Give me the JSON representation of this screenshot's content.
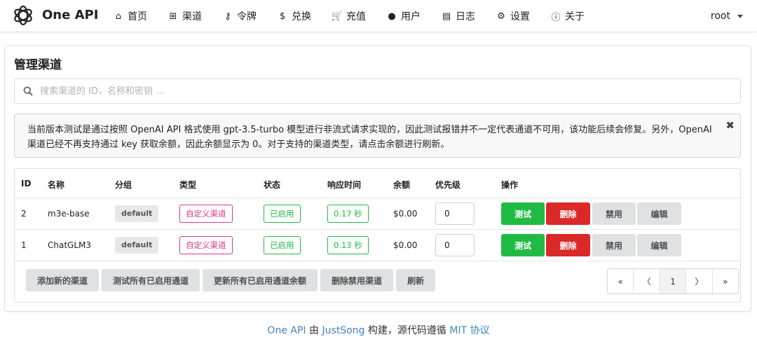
{
  "nav": {
    "brand": "One API",
    "items": [
      {
        "label": "首页",
        "icon": "home-icon",
        "glyph": "⌂"
      },
      {
        "label": "渠道",
        "icon": "sitemap-icon",
        "glyph": "⊞"
      },
      {
        "label": "令牌",
        "icon": "key-icon",
        "glyph": "⚷"
      },
      {
        "label": "兑换",
        "icon": "dollar-icon",
        "glyph": "$"
      },
      {
        "label": "充值",
        "icon": "cart-icon",
        "glyph": "🛒"
      },
      {
        "label": "用户",
        "icon": "user-icon",
        "glyph": "●"
      },
      {
        "label": "日志",
        "icon": "book-icon",
        "glyph": "▤"
      },
      {
        "label": "设置",
        "icon": "gear-icon",
        "glyph": "⚙"
      },
      {
        "label": "关于",
        "icon": "info-icon",
        "glyph": "ⓘ"
      }
    ],
    "user": "root"
  },
  "page": {
    "title": "管理渠道",
    "search_placeholder": "搜索渠道的 ID，名称和密钥 ...",
    "notice": "当前版本测试是通过按照 OpenAI API 格式使用 gpt-3.5-turbo 模型进行非流式请求实现的，因此测试报错并不一定代表通道不可用，该功能后续会修复。另外，OpenAI 渠道已经不再支持通过 key 获取余额，因此余额显示为 0。对于支持的渠道类型，请点击余额进行刷新。",
    "notice_close": "✖"
  },
  "table": {
    "headers": [
      "ID",
      "名称",
      "分组",
      "类型",
      "状态",
      "响应时间",
      "余额",
      "优先级",
      "操作"
    ],
    "rows": [
      {
        "id": "2",
        "name": "m3e-base",
        "group": "default",
        "type": "自定义渠道",
        "status": "已启用",
        "response": "0.17 秒",
        "balance": "$0.00",
        "priority": "0"
      },
      {
        "id": "1",
        "name": "ChatGLM3",
        "group": "default",
        "type": "自定义渠道",
        "status": "已启用",
        "response": "0.13 秒",
        "balance": "$0.00",
        "priority": "0"
      }
    ],
    "actions": {
      "test": "测试",
      "delete": "删除",
      "disable": "禁用",
      "edit": "编辑"
    }
  },
  "footer_buttons": [
    "添加新的渠道",
    "测试所有已启用通道",
    "更新所有已启用通道余额",
    "删除禁用渠道",
    "刷新"
  ],
  "pagination": {
    "first": "«",
    "prev": "〈",
    "current": "1",
    "next": "〉",
    "last": "»"
  },
  "site_footer": {
    "project": "One API",
    "by": " 由 ",
    "author": "JustSong",
    "middle": " 构建，源代码遵循 ",
    "license": "MIT 协议"
  },
  "colors": {
    "green": "#21ba45",
    "red": "#db2828",
    "pink": "#d9398a",
    "link": "#4183c4"
  }
}
